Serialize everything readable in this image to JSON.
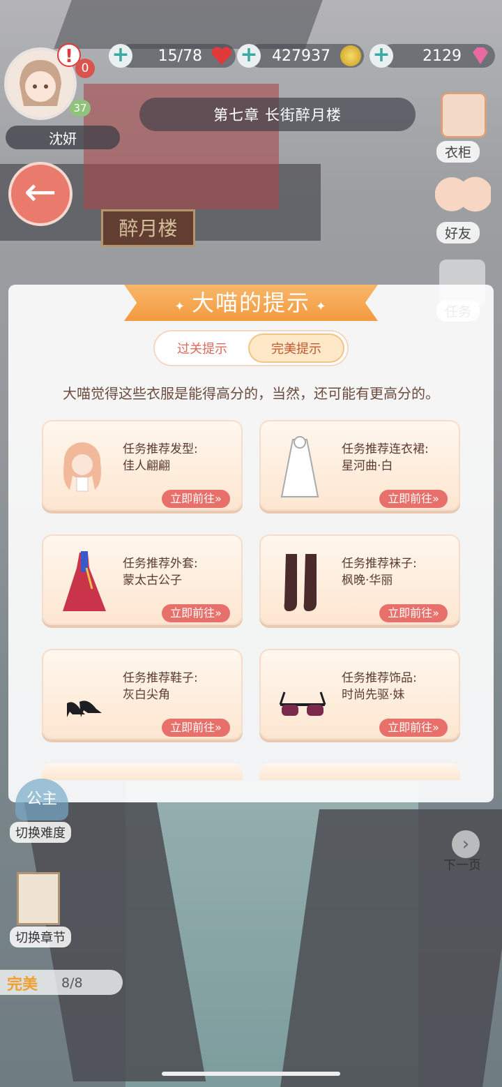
{
  "player": {
    "name": "沈妍",
    "level": "37",
    "alert": "!",
    "notify_count": "0"
  },
  "resources": [
    {
      "icon": "heart-icon",
      "value": "15/78",
      "color": "#e03a3a"
    },
    {
      "icon": "coin-icon",
      "value": "427937",
      "color": "#d8b433"
    },
    {
      "icon": "diamond-icon",
      "value": "2129",
      "color": "#e86aa0"
    }
  ],
  "chapter_title": "第七章 长街醉月楼",
  "sign_text": "醉月楼",
  "side_menu": [
    {
      "label": "衣柜",
      "icon": "wardrobe-icon"
    },
    {
      "label": "好友",
      "icon": "friends-icon"
    },
    {
      "label": "任务",
      "icon": "task-icon"
    }
  ],
  "modal": {
    "title": "大喵的提示",
    "tabs": [
      {
        "label": "过关提示",
        "active": false
      },
      {
        "label": "完美提示",
        "active": true
      }
    ],
    "hint": "大喵觉得这些衣服是能得高分的，当然，还可能有更高分的。",
    "go_label": "立即前往»",
    "cards": [
      {
        "category": "任务推荐发型:",
        "item": "佳人翩翩",
        "icon": "hairstyle-icon"
      },
      {
        "category": "任务推荐连衣裙:",
        "item": "星河曲·白",
        "icon": "dress-icon"
      },
      {
        "category": "任务推荐外套:",
        "item": "蒙太古公子",
        "icon": "coat-icon"
      },
      {
        "category": "任务推荐袜子:",
        "item": "枫晚·华丽",
        "icon": "socks-icon"
      },
      {
        "category": "任务推荐鞋子:",
        "item": "灰白尖角",
        "icon": "shoes-icon"
      },
      {
        "category": "任务推荐饰品:",
        "item": "时尚先驱·妹",
        "icon": "sunglasses-icon"
      }
    ]
  },
  "bottom": {
    "difficulty_badge": "公主",
    "difficulty_label": "切换难度",
    "chapter_label": "切换章节",
    "next_label": "下一页",
    "perfect_label": "完美",
    "perfect_count": "8/8"
  }
}
